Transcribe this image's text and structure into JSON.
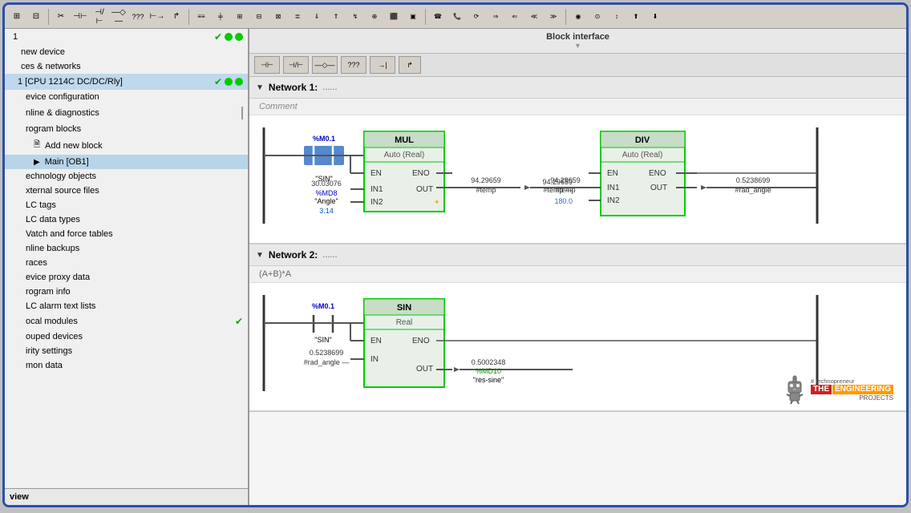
{
  "toolbar": {
    "title": "Block interface",
    "buttons": [
      "grid",
      "grid2",
      "cut",
      "copy",
      "paste",
      "compile",
      "download",
      "monitor"
    ]
  },
  "sidebar": {
    "items": [
      {
        "id": "item-1",
        "label": "1",
        "hasCheck": false,
        "hasDotGreen": true,
        "hasDotGreen2": true,
        "indent": 0
      },
      {
        "id": "item-new-device",
        "label": "new device",
        "hasCheck": false,
        "hasDot": false,
        "indent": 1
      },
      {
        "id": "item-ces",
        "label": "ces & networks",
        "hasCheck": false,
        "indent": 1
      },
      {
        "id": "item-cpu",
        "label": "1 [CPU 1214C DC/DC/Rly]",
        "hasCheck": true,
        "hasDotGreen": true,
        "hasDotGreen2": true,
        "indent": 1,
        "active": true
      },
      {
        "id": "item-dev-config",
        "label": "evice configuration",
        "hasCheck": false,
        "indent": 2
      },
      {
        "id": "item-inline-diag",
        "label": "nline & diagnostics",
        "hasCheck": false,
        "indent": 2
      },
      {
        "id": "item-prog-blocks",
        "label": "rogram blocks",
        "hasCheck": false,
        "hasDotGreen": true,
        "indent": 2
      },
      {
        "id": "item-add-block",
        "label": "Add new block",
        "hasCheck": false,
        "indent": 3
      },
      {
        "id": "item-main-ob1",
        "label": "Main [OB1]",
        "hasCheck": false,
        "hasDotGreen": true,
        "indent": 3,
        "highlighted": true
      },
      {
        "id": "item-tech-obj",
        "label": "echnology objects",
        "hasCheck": false,
        "indent": 2
      },
      {
        "id": "item-ext-src",
        "label": "xternal source files",
        "hasCheck": false,
        "indent": 2
      },
      {
        "id": "item-plc-tags",
        "label": "LC tags",
        "hasCheck": false,
        "hasDotGreen": true,
        "indent": 2
      },
      {
        "id": "item-plc-data",
        "label": "LC data types",
        "hasCheck": false,
        "indent": 2
      },
      {
        "id": "item-watch",
        "label": "Vatch and force tables",
        "hasCheck": false,
        "indent": 2
      },
      {
        "id": "item-backups",
        "label": "nline backups",
        "hasCheck": false,
        "indent": 2
      },
      {
        "id": "item-traces",
        "label": "races",
        "hasCheck": false,
        "indent": 2
      },
      {
        "id": "item-proxy",
        "label": "evice proxy data",
        "hasCheck": false,
        "indent": 2
      },
      {
        "id": "item-prog-info",
        "label": "rogram info",
        "hasCheck": false,
        "indent": 2
      },
      {
        "id": "item-alarms",
        "label": "LC alarm text lists",
        "hasCheck": false,
        "indent": 2
      },
      {
        "id": "item-local-mod",
        "label": "ocal modules",
        "hasCheck": true,
        "indent": 2
      },
      {
        "id": "item-grouped",
        "label": "ouped devices",
        "hasCheck": false,
        "indent": 2
      },
      {
        "id": "item-security",
        "label": "irity settings",
        "hasCheck": false,
        "indent": 2
      },
      {
        "id": "item-common",
        "label": "mon data",
        "hasCheck": false,
        "indent": 2
      }
    ],
    "view_label": "view"
  },
  "network1": {
    "title": "Network 1:",
    "dots": "......",
    "comment": "Comment",
    "contact1_tag": "%M0.1",
    "contact1_name": "\"SIN\"",
    "mul_name": "MUL",
    "mul_sub": "Auto (Real)",
    "val_30": "30.03076",
    "val_md8": "%MD8",
    "val_angle": "\"Angle\"",
    "val_314": "3.14",
    "out_val1": "94.29659",
    "out_label1": "#temp",
    "div_name": "DIV",
    "div_sub": "Auto (Real)",
    "in_val_94": "94.29659",
    "in_label_temp": "#temp",
    "in_val_180": "180.0",
    "out_val2": "0.5238699",
    "out_label2": "#rad_angle"
  },
  "network2": {
    "title": "Network 2:",
    "dots": "......",
    "formula": "(A+B)*A",
    "contact1_tag": "%M0.1",
    "contact1_name": "\"SIN\"",
    "sin_name": "SIN",
    "sin_sub": "Real",
    "in_val": "0.5238699",
    "in_label": "#rad_angle",
    "out_val": "0.5002348",
    "out_md10": "%MD10",
    "out_name": "\"res-sine\""
  },
  "watermark": {
    "hashtag": "# technopreneur",
    "the": "THE",
    "engineering": "ENGINEERING",
    "projects": "PROJECTS"
  }
}
